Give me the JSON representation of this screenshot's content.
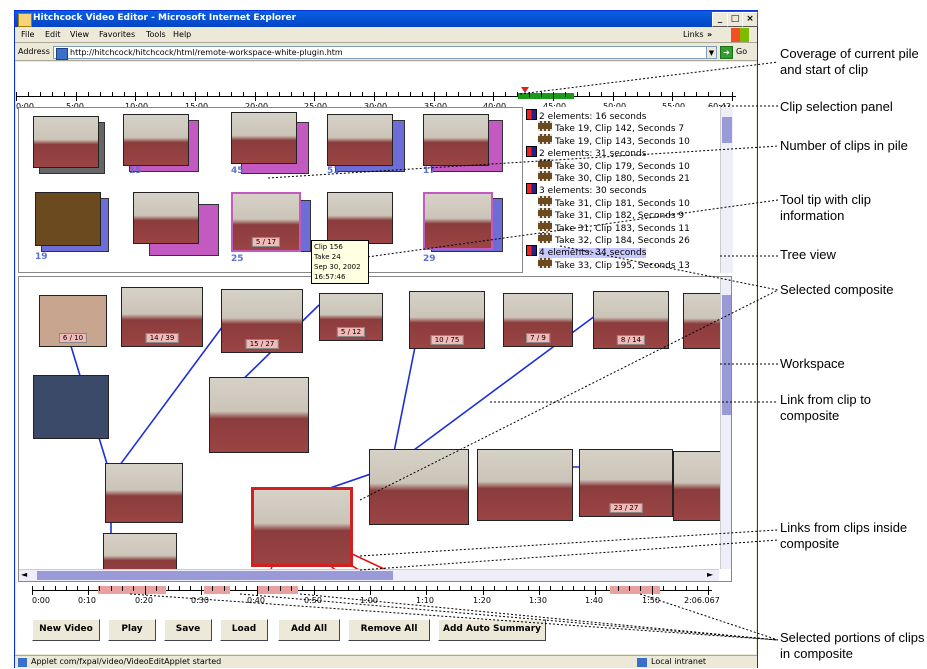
{
  "window": {
    "title": "Hitchcock Video Editor - Microsoft Internet Explorer",
    "menu": [
      "File",
      "Edit",
      "View",
      "Favorites",
      "Tools",
      "Help"
    ],
    "links_label": "Links",
    "address_label": "Address",
    "url": "http://hitchcock/hitchcock/html/remote-workspace-white-plugin.htm",
    "go_label": "Go"
  },
  "top_timeline": {
    "labels": [
      "0:00",
      "5:00",
      "10:00",
      "15:00",
      "20:00",
      "25:00",
      "30:00",
      "35:00",
      "40:00",
      "45:00",
      "50:00",
      "55:00",
      "60:42"
    ],
    "coverage_color": "#1a9a1a",
    "clip_start_marker_color": "#e02020"
  },
  "clip_selection": {
    "pile_counts": [
      "15",
      "45",
      "51",
      "17",
      "19",
      "25",
      "29"
    ],
    "thumb_labels": [
      "5 / 17"
    ],
    "tooltip": [
      "Clip 156",
      "Take 24",
      "Sep 30, 2002",
      "16:57:46"
    ]
  },
  "tree": [
    {
      "kind": "group",
      "text": "2 elements: 16 seconds"
    },
    {
      "kind": "clip",
      "text": "Take 19, Clip 142, Seconds 7"
    },
    {
      "kind": "clip",
      "text": "Take 19, Clip 143, Seconds 10"
    },
    {
      "kind": "group",
      "text": "2 elements: 31 seconds"
    },
    {
      "kind": "clip",
      "text": "Take 30, Clip 179, Seconds 10"
    },
    {
      "kind": "clip",
      "text": "Take 30, Clip 180, Seconds 21"
    },
    {
      "kind": "group",
      "text": "3 elements: 30 seconds"
    },
    {
      "kind": "clip",
      "text": "Take 31, Clip 181, Seconds 10"
    },
    {
      "kind": "clip",
      "text": "Take 31, Clip 182, Seconds 9"
    },
    {
      "kind": "clip",
      "text": "Take 31, Clip 183, Seconds 11"
    },
    {
      "kind": "clip",
      "text": "Take 32, Clip 184, Seconds 26"
    },
    {
      "kind": "group",
      "text": "4 elements: 34 seconds"
    },
    {
      "kind": "clip",
      "text": "Take 33, Clip 195, Seconds 13"
    }
  ],
  "workspace": {
    "thumb_labels": [
      "6 / 10",
      "14 / 39",
      "15 / 27",
      "5 / 12",
      "10 / 75",
      "7 / 9",
      "8 / 14",
      "23 / 27"
    ]
  },
  "bottom_timeline": {
    "labels": [
      "0:00",
      "0:10",
      "0:20",
      "0:30",
      "0:40",
      "0:50",
      "1:00",
      "1:10",
      "1:20",
      "1:30",
      "1:40",
      "1:50",
      "2:06.067"
    ],
    "selected_color": "#e8a0a0"
  },
  "buttons": [
    "New Video",
    "Play",
    "Save",
    "Load",
    "Add All",
    "Remove All",
    "Add Auto Summary"
  ],
  "status": {
    "text": "Applet com/fxpal/video/VideoEditApplet started",
    "zone": "Local intranet"
  },
  "annotations": [
    "Coverage of current pile and start of clip",
    "Clip selection panel",
    "Number of clips in pile",
    "Tool tip with clip information",
    "Tree view",
    "Selected composite",
    "Workspace",
    "Link from clip to composite",
    "Links from clips inside composite",
    "Selected portions of clips in composite"
  ]
}
